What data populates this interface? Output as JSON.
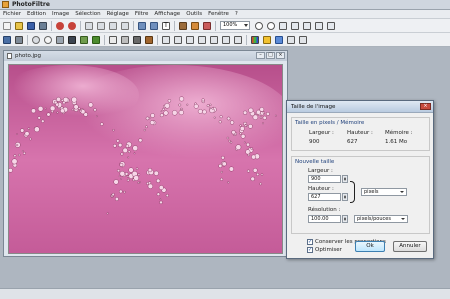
{
  "app": {
    "title": "PhotoFiltre"
  },
  "menu": [
    "Fichier",
    "Edition",
    "Image",
    "Sélection",
    "Réglage",
    "Filtre",
    "Affichage",
    "Outils",
    "Fenêtre",
    "?"
  ],
  "toolbar": {
    "zoom_value": "100%"
  },
  "image_window": {
    "title": "photo.jpg"
  },
  "dialog": {
    "title": "Taille de l'image",
    "memory_section": {
      "title": "Taille en pixels / Mémoire",
      "labels": [
        "Largeur :",
        "Hauteur :",
        "Mémoire :"
      ],
      "values": [
        "900",
        "627",
        "1.61 Mo"
      ]
    },
    "new_size": {
      "title": "Nouvelle taille",
      "width_label": "Largeur :",
      "width_value": "900",
      "height_label": "Hauteur :",
      "height_value": "627",
      "unit": "pixels",
      "resolution_label": "Résolution :",
      "resolution_value": "100.00",
      "resolution_unit": "pixels/pouces"
    },
    "keep_proportions_label": "Conserver les proportions",
    "optimize_label": "Optimiser",
    "ok_label": "Ok",
    "cancel_label": "Annuler"
  },
  "colors": {
    "photo_bg": "#d06aa3",
    "accent": "#3c7fb1"
  }
}
